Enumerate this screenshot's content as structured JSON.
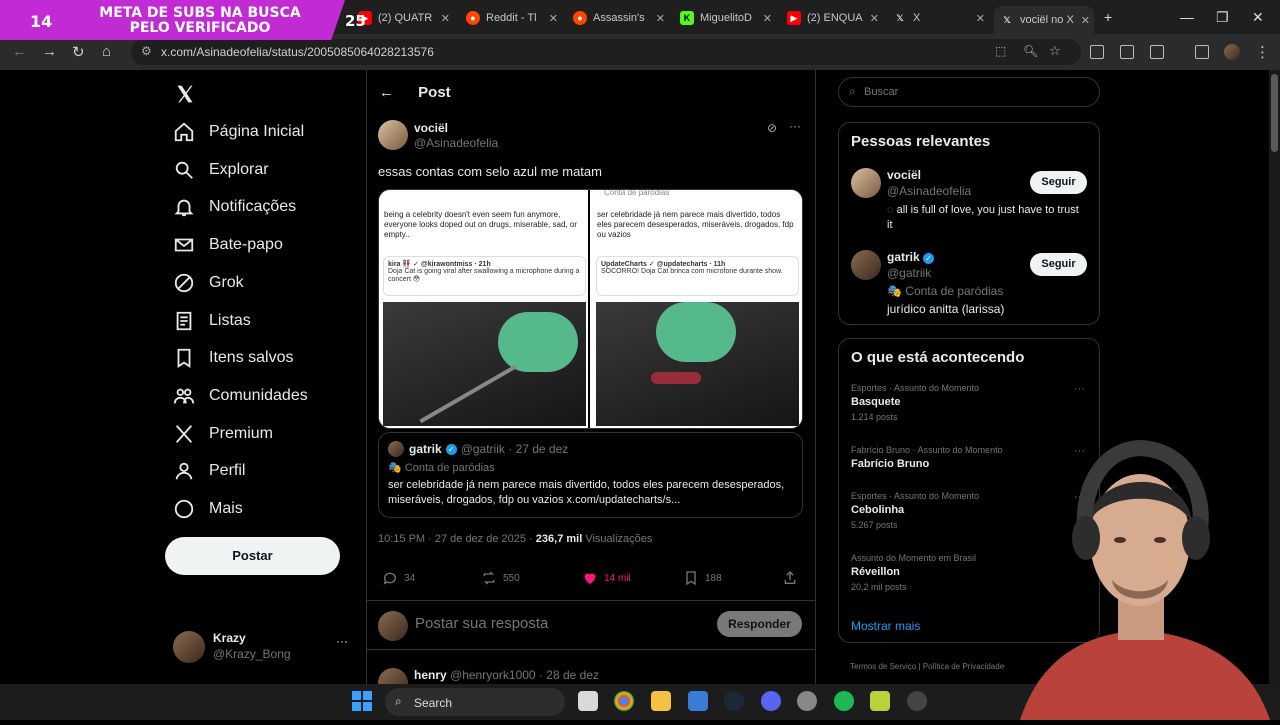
{
  "overlay": {
    "num_left": "14",
    "text": "META DE SUBS NA BUSCA PELO VERIFICADO",
    "num_right": "25"
  },
  "browser": {
    "tabs": [
      {
        "label": "(2) QUATR",
        "color": "#ff0000"
      },
      {
        "label": "Reddit - Tl",
        "color": "#ff4500"
      },
      {
        "label": "Assassin's",
        "color": "#ff4500"
      },
      {
        "label": "MiguelitoD",
        "color": "#53fc18"
      },
      {
        "label": "(2) ENQUA",
        "color": "#ff0000"
      },
      {
        "label": "X",
        "color": "#000000"
      },
      {
        "label": "vociël no X",
        "color": "#000000"
      }
    ],
    "url": "x.com/Asinadeofelia/status/2005085064028213576"
  },
  "nav": {
    "items": [
      {
        "label": "Página Inicial",
        "icon": "home-icon"
      },
      {
        "label": "Explorar",
        "icon": "search-icon"
      },
      {
        "label": "Notificações",
        "icon": "bell-icon"
      },
      {
        "label": "Bate-papo",
        "icon": "mail-icon"
      },
      {
        "label": "Grok",
        "icon": "grok-icon"
      },
      {
        "label": "Listas",
        "icon": "list-icon"
      },
      {
        "label": "Itens salvos",
        "icon": "bookmark-icon"
      },
      {
        "label": "Comunidades",
        "icon": "people-icon"
      },
      {
        "label": "Premium",
        "icon": "x-logo-icon"
      },
      {
        "label": "Perfil",
        "icon": "person-icon"
      },
      {
        "label": "Mais",
        "icon": "more-circle-icon"
      }
    ],
    "post_label": "Postar",
    "me": {
      "name": "Krazy",
      "handle": "@Krazy_Bong"
    }
  },
  "post": {
    "header": "Post",
    "author_name": "vociël",
    "author_handle": "@Asinadeofelia",
    "text": "essas contas com selo azul me matam",
    "media": {
      "left_text": "being a celebrity doesn't even seem fun anymore, everyone looks doped out on drugs, miserable, sad, or empty..",
      "left_quote_user": "kira 👭 ✓ @kirawontmiss · 21h",
      "left_quote_text": "Doja Cat is going viral after swallowing a microphone during a concert 😳",
      "right_top": "Conta de paródias",
      "right_text": "ser celebridade já nem parece mais divertido, todos eles parecem desesperados, miseráveis, drogados, fdp ou vazios",
      "right_quote_user": "UpdateCharts ✓ @updatecharts · 11h",
      "right_quote_text": "SOCORRO! Doja Cat brinca com microfone durante show."
    },
    "quote": {
      "name": "gatrik",
      "handle": "@gatriik",
      "date": "27 de dez",
      "badge": "Conta de paródias",
      "text": "ser celebridade já nem parece mais divertido, todos eles parecem desesperados, miseráveis, drogados, fdp ou vazios x.com/updatecharts/s..."
    },
    "time": "10:15 PM · 27 de dez de 2025 ·",
    "views": "236,7 mil",
    "views_label": "Visualizações",
    "stats": {
      "replies": "34",
      "reposts": "550",
      "likes": "14 mil",
      "bookmarks": "188"
    },
    "reply_placeholder": "Postar sua resposta",
    "reply_button": "Responder",
    "next_reply": {
      "name": "henry",
      "handle": "@henryork1000",
      "date": "28 de dez"
    }
  },
  "sidebar": {
    "search_placeholder": "Buscar",
    "relevant_title": "Pessoas relevantes",
    "people": [
      {
        "name": "vociël",
        "handle": "@Asinadeofelia",
        "bio": "all is full of love, you just have to trust it",
        "button": "Seguir"
      },
      {
        "name": "gatrik",
        "handle": "@gatriik",
        "badge": "Conta de paródias",
        "bio": "jurídico anitta (larissa)",
        "button": "Seguir"
      }
    ],
    "trends_title": "O que está acontecendo",
    "trends": [
      {
        "category": "Esportes · Assunto do Momento",
        "name": "Basquete",
        "count": "1.214 posts"
      },
      {
        "category": "Fabrício Bruno · Assunto do Momento",
        "name": "Fabrício Bruno",
        "count": ""
      },
      {
        "category": "Esportes · Assunto do Momento",
        "name": "Cebolinha",
        "count": "5.267 posts"
      },
      {
        "category": "Assunto do Momento em Brasil",
        "name": "Réveillon",
        "count": "20,2 mil posts"
      }
    ],
    "show_more": "Mostrar mais",
    "footer": "Termos de Serviço  |  Política de Privacidade"
  },
  "taskbar": {
    "search_placeholder": "Search"
  },
  "colors": {
    "like": "#f91880",
    "verified": "#1d9bf0",
    "overlay": "#c22bd3",
    "link": "#1d9bf0"
  }
}
